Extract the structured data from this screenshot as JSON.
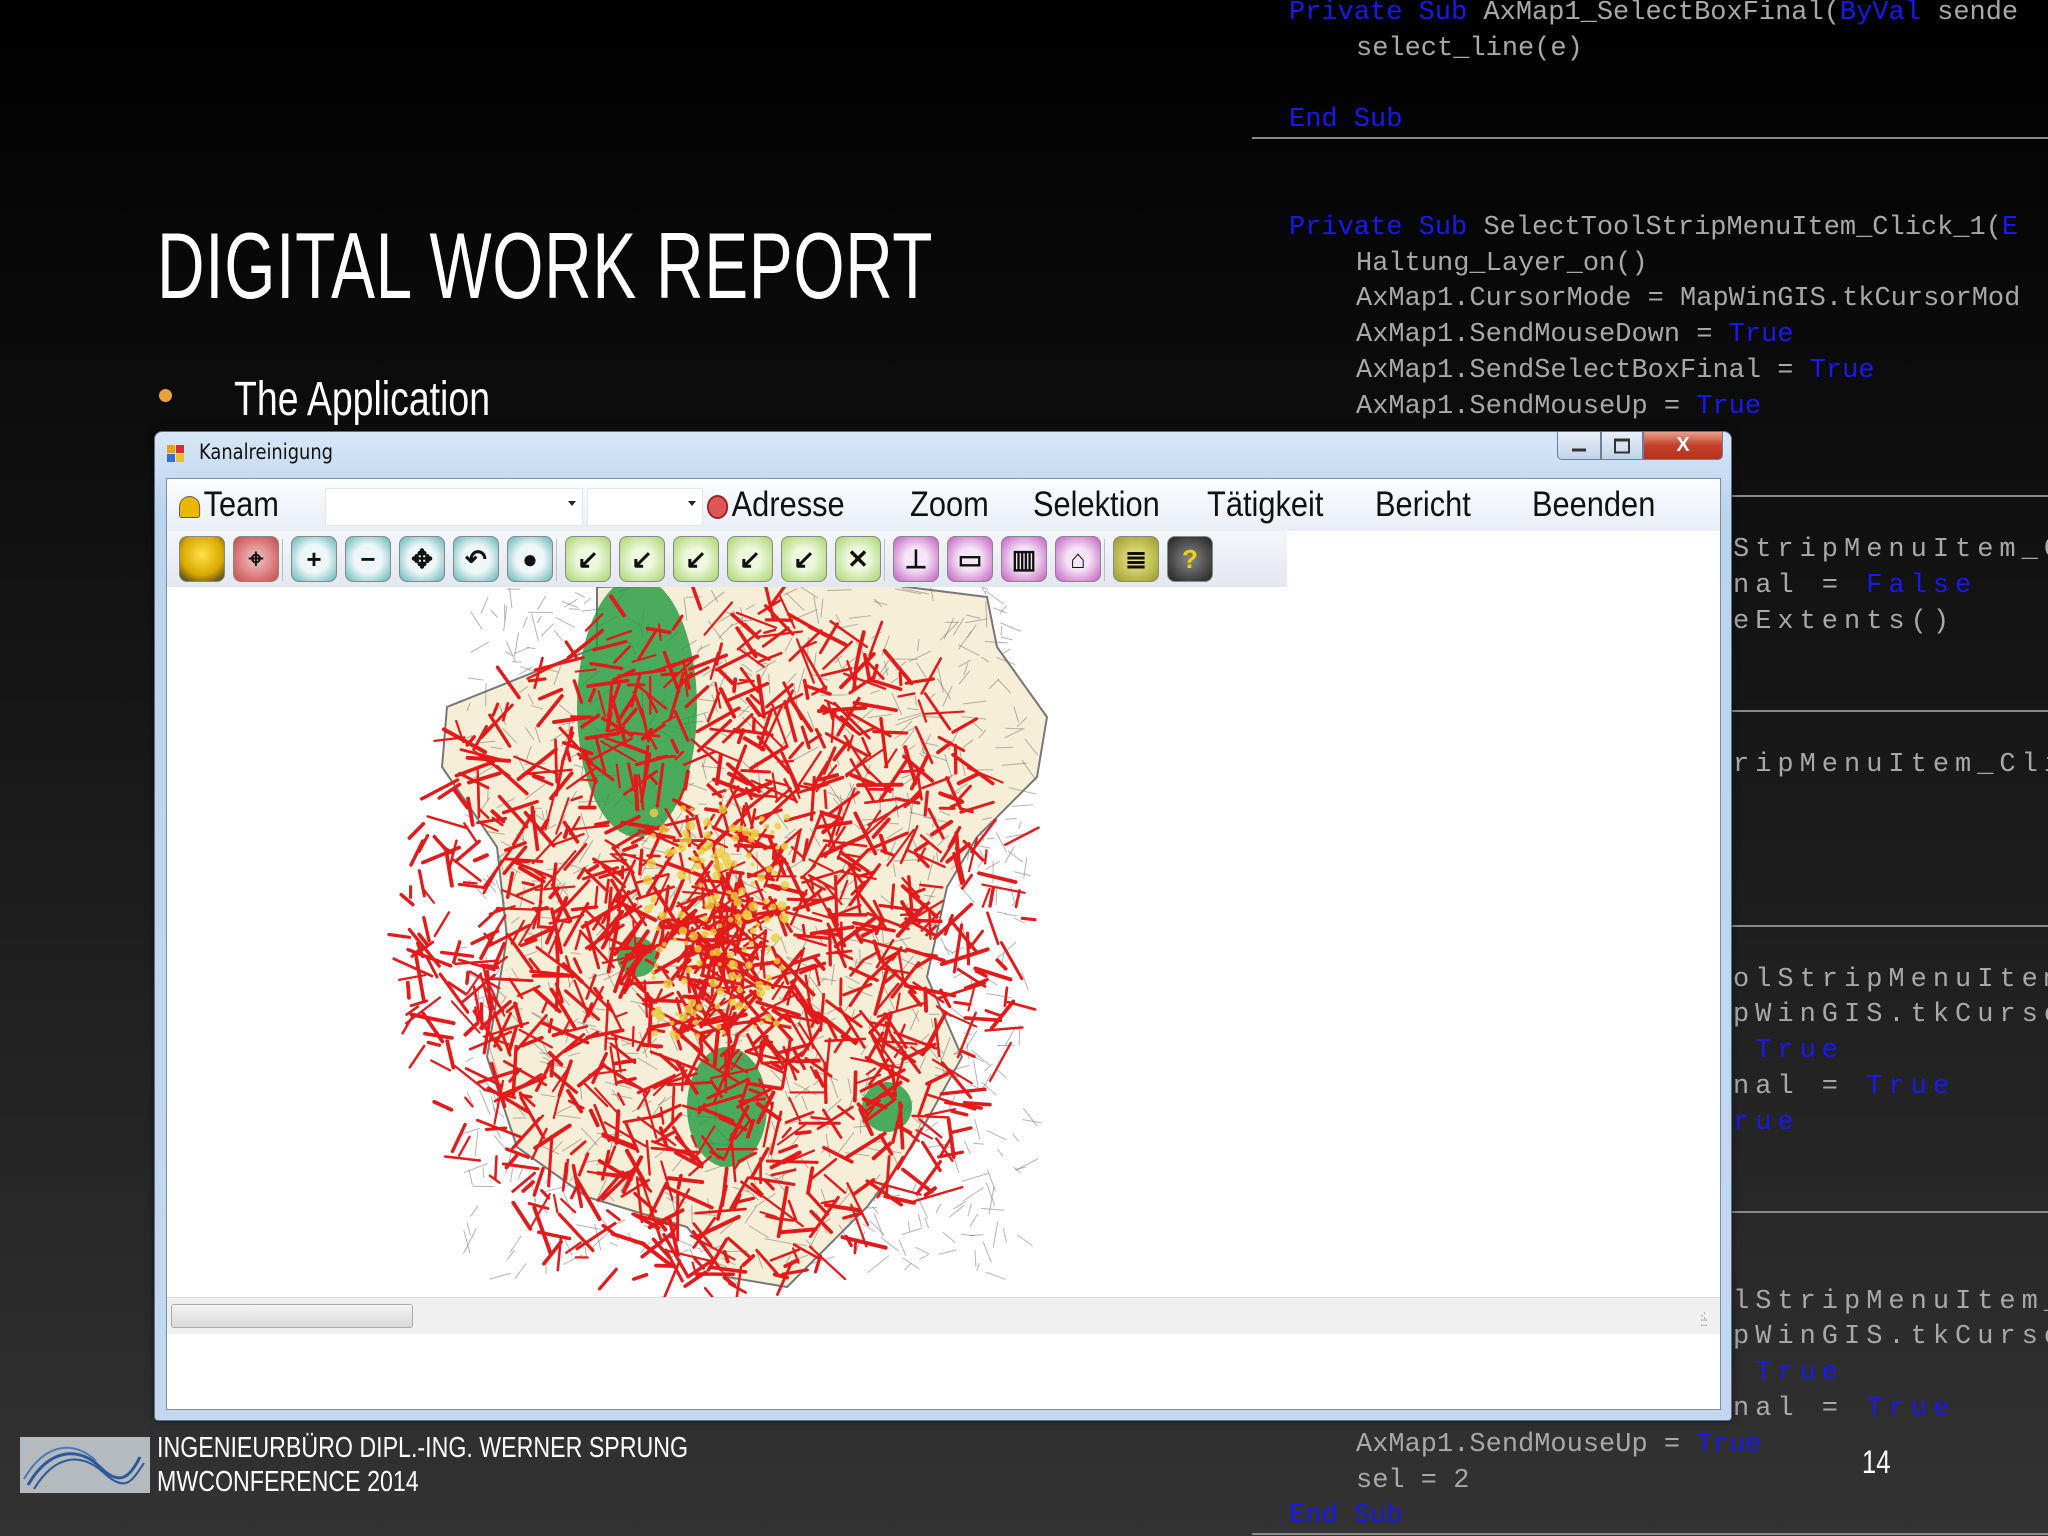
{
  "slide": {
    "title": "DIGITAL WORK REPORT",
    "bullet": "The Application",
    "bullet_color": "#e8a23a",
    "footer_line1": "INGENIEURBÜRO DIPL.-ING. WERNER SPRUNG",
    "footer_line2": "MWCONFERENCE 2014",
    "page_number": "14"
  },
  "code": {
    "keyword_color": "#1818f0",
    "rows": [
      {
        "type": "sig",
        "tokens": [
          [
            "Private Sub ",
            "k"
          ],
          [
            "AxMap1_SelectBoxFinal(",
            "p"
          ],
          [
            "ByVal",
            "k"
          ],
          [
            " sende",
            "p"
          ]
        ]
      },
      {
        "type": "body",
        "tokens": [
          [
            "select_line(e)",
            "p"
          ]
        ]
      },
      {
        "type": "blank"
      },
      {
        "type": "sig",
        "rule": true,
        "tokens": [
          [
            "End Sub",
            "k"
          ]
        ]
      },
      {
        "type": "blank"
      },
      {
        "type": "blank"
      },
      {
        "type": "sig",
        "tokens": [
          [
            "Private Sub ",
            "k"
          ],
          [
            "SelectToolStripMenuItem_Click_1(",
            "p"
          ],
          [
            "E",
            "k"
          ]
        ]
      },
      {
        "type": "body",
        "tokens": [
          [
            "Haltung_Layer_on()",
            "p"
          ]
        ]
      },
      {
        "type": "body",
        "tokens": [
          [
            "AxMap1.CursorMode = MapWinGIS.tkCursorMod",
            "p"
          ]
        ]
      },
      {
        "type": "body",
        "tokens": [
          [
            "AxMap1.SendMouseDown = ",
            "p"
          ],
          [
            "True",
            "k"
          ]
        ]
      },
      {
        "type": "body",
        "tokens": [
          [
            "AxMap1.SendSelectBoxFinal = ",
            "p"
          ],
          [
            "True",
            "k"
          ]
        ]
      },
      {
        "type": "body",
        "tokens": [
          [
            "AxMap1.SendMouseUp = ",
            "p"
          ],
          [
            "True",
            "k"
          ]
        ]
      },
      {
        "type": "blank"
      },
      {
        "type": "blank",
        "rule": true
      },
      {
        "type": "blank"
      },
      {
        "type": "frag",
        "tokens": [
          [
            "StripMenuItem_Click",
            "p"
          ]
        ]
      },
      {
        "type": "frag",
        "tokens": [
          [
            "nal = ",
            "p"
          ],
          [
            "False",
            "k"
          ]
        ]
      },
      {
        "type": "frag",
        "tokens": [
          [
            "eExtents()",
            "p"
          ]
        ]
      },
      {
        "type": "blank"
      },
      {
        "type": "blank",
        "rule": true
      },
      {
        "type": "blank"
      },
      {
        "type": "frag",
        "tokens": [
          [
            "ripMenuItem_Click(",
            "p"
          ],
          [
            "E",
            "k"
          ]
        ]
      },
      {
        "type": "blank"
      },
      {
        "type": "blank"
      },
      {
        "type": "blank"
      },
      {
        "type": "blank",
        "rule": true
      },
      {
        "type": "blank"
      },
      {
        "type": "frag",
        "tokens": [
          [
            "olStripMenuItem_Cli",
            "p"
          ]
        ]
      },
      {
        "type": "frag",
        "tokens": [
          [
            "pWinGIS.tkCursorMod",
            "p"
          ]
        ]
      },
      {
        "type": "frag",
        "tokens": [
          [
            " ",
            "p"
          ],
          [
            "True",
            "k"
          ]
        ]
      },
      {
        "type": "frag",
        "tokens": [
          [
            "nal = ",
            "p"
          ],
          [
            "True",
            "k"
          ]
        ]
      },
      {
        "type": "frag",
        "tokens": [
          [
            "rue",
            "k"
          ]
        ]
      },
      {
        "type": "blank"
      },
      {
        "type": "blank",
        "rule": true
      },
      {
        "type": "blank"
      },
      {
        "type": "blank"
      },
      {
        "type": "frag",
        "tokens": [
          [
            "lStripMenuItem_Clic",
            "p"
          ]
        ]
      },
      {
        "type": "frag",
        "tokens": [
          [
            "pWinGIS.tkCursorMod",
            "p"
          ]
        ]
      },
      {
        "type": "frag",
        "tokens": [
          [
            " ",
            "p"
          ],
          [
            "True",
            "k"
          ]
        ]
      },
      {
        "type": "frag",
        "tokens": [
          [
            "nal = ",
            "p"
          ],
          [
            "True",
            "k"
          ]
        ]
      },
      {
        "type": "body",
        "tokens": [
          [
            "AxMap1.SendMouseUp = ",
            "p"
          ],
          [
            "True",
            "k"
          ]
        ]
      },
      {
        "type": "body",
        "tokens": [
          [
            "sel = 2",
            "p"
          ]
        ]
      },
      {
        "type": "sig",
        "rule": true,
        "tokens": [
          [
            "End Sub",
            "k"
          ]
        ]
      }
    ]
  },
  "window": {
    "title": "Kanalreinigung",
    "close_glyph": "X",
    "menu": {
      "team": "Team",
      "combo1_value": "",
      "combo2_value": "",
      "adresse": "Adresse",
      "zoom": "Zoom",
      "selektion": "Selektion",
      "taetigkeit": "Tätigkeit",
      "bericht": "Bericht",
      "beenden": "Beenden"
    },
    "toolbar": [
      {
        "name": "team-helmet",
        "color": "yellow",
        "glyph": ""
      },
      {
        "name": "address-target",
        "color": "red",
        "glyph": "⌖"
      },
      {
        "name": "zoom-in",
        "color": "teal",
        "glyph": "+"
      },
      {
        "name": "zoom-out",
        "color": "teal",
        "glyph": "−"
      },
      {
        "name": "pan",
        "color": "teal",
        "glyph": "✥"
      },
      {
        "name": "previous-view",
        "color": "teal",
        "glyph": "↶"
      },
      {
        "name": "full-extent",
        "color": "teal",
        "glyph": "●"
      },
      {
        "name": "select-pipe",
        "color": "green",
        "glyph": "↙"
      },
      {
        "name": "add-pipe-selection",
        "color": "green",
        "glyph": "↙"
      },
      {
        "name": "remove-pipe-selection",
        "color": "green",
        "glyph": "↙"
      },
      {
        "name": "select-pipe-device",
        "color": "green",
        "glyph": "↙"
      },
      {
        "name": "select-pipe-grid",
        "color": "green",
        "glyph": "↙"
      },
      {
        "name": "clear-pipe-selection",
        "color": "green",
        "glyph": "✕"
      },
      {
        "name": "manhole",
        "color": "purple",
        "glyph": "⊥"
      },
      {
        "name": "camera-inspection",
        "color": "purple",
        "glyph": "▭"
      },
      {
        "name": "grate",
        "color": "purple",
        "glyph": "▥"
      },
      {
        "name": "house-connection",
        "color": "purple",
        "glyph": "⌂"
      },
      {
        "name": "report-scroll",
        "color": "olive",
        "glyph": "≣"
      },
      {
        "name": "help",
        "color": "dark",
        "glyph": "?"
      }
    ],
    "map_colors": {
      "parcel": "#f6eed6",
      "pipe": "#e41a1a",
      "cleaned": "#1e9a3c",
      "outline": "#777777"
    }
  }
}
